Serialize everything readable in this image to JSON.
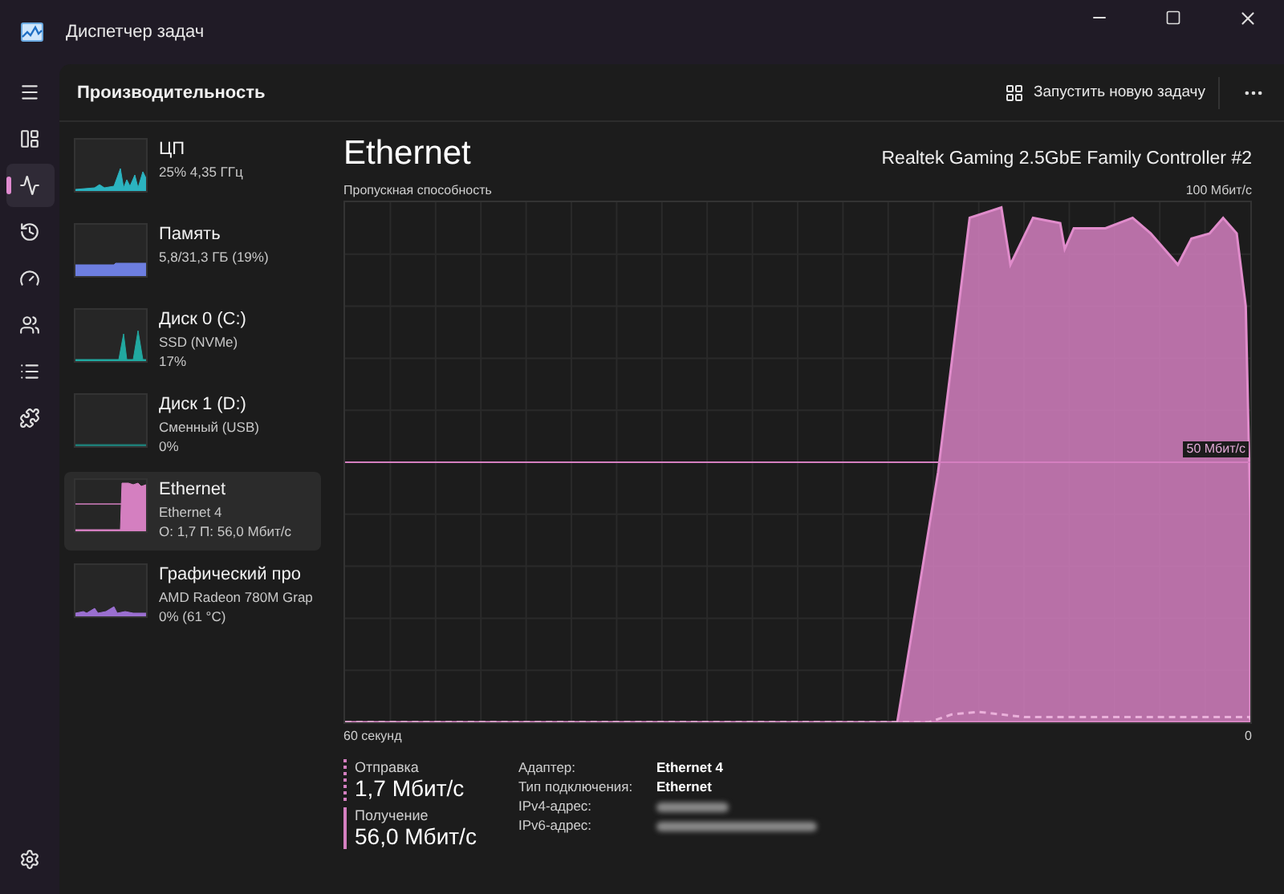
{
  "window": {
    "title": "Диспетчер задач"
  },
  "nav_items": [
    {
      "selected": false
    },
    {
      "selected": false
    },
    {
      "selected": true
    },
    {
      "selected": false
    },
    {
      "selected": false
    },
    {
      "selected": false
    },
    {
      "selected": false
    },
    {
      "selected": false
    }
  ],
  "page": {
    "title": "Производительность",
    "run_task": "Запустить новую задачу"
  },
  "resources": [
    {
      "kind": "cpu",
      "name": "ЦП",
      "lines": [
        "25%  4,35 ГГц"
      ],
      "color": "#2bb3c0",
      "selected": false
    },
    {
      "kind": "memory",
      "name": "Память",
      "lines": [
        "5,8/31,3 ГБ (19%)"
      ],
      "color": "#6d7ee0",
      "selected": false
    },
    {
      "kind": "disk",
      "name": "Диск 0 (C:)",
      "lines": [
        "SSD (NVMe)",
        "17%"
      ],
      "color": "#21a8a0",
      "selected": false
    },
    {
      "kind": "idle",
      "name": "Диск 1 (D:)",
      "lines": [
        "Сменный (USB)",
        "0%"
      ],
      "color": "#1e7f78",
      "selected": false
    },
    {
      "kind": "network",
      "name": "Ethernet",
      "lines": [
        "Ethernet 4",
        "О: 1,7 П: 56,0 Мбит/с"
      ],
      "color": "#d47fc0",
      "selected": true
    },
    {
      "kind": "gpu",
      "name": "Графический про",
      "lines": [
        "AMD Radeon 780M Grap",
        "0%  (61 °C)"
      ],
      "color": "#9a6fd0",
      "selected": false
    }
  ],
  "detail": {
    "title": "Ethernet",
    "device": "Realtek Gaming 2.5GbE Family Controller #2",
    "graph": {
      "label": "Пропускная способность",
      "max_label": "100 Мбит/с",
      "mid_label": "50 Мбит/с",
      "start_label": "60 секунд",
      "end_label": "0"
    },
    "stats": [
      {
        "kind": "send",
        "label": "Отправка",
        "value": "1,7 Мбит/с"
      },
      {
        "kind": "receive",
        "label": "Получение",
        "value": "56,0 Мбит/с"
      }
    ],
    "properties": [
      {
        "kind": "text",
        "label": "Адаптер:",
        "value": "Ethernet 4"
      },
      {
        "kind": "text",
        "label": "Тип подключения:",
        "value": "Ethernet"
      },
      {
        "kind": "hidden",
        "label": "IPv4-адрес:"
      },
      {
        "kind": "hidden",
        "label": "IPv6-адрес:"
      }
    ]
  }
}
